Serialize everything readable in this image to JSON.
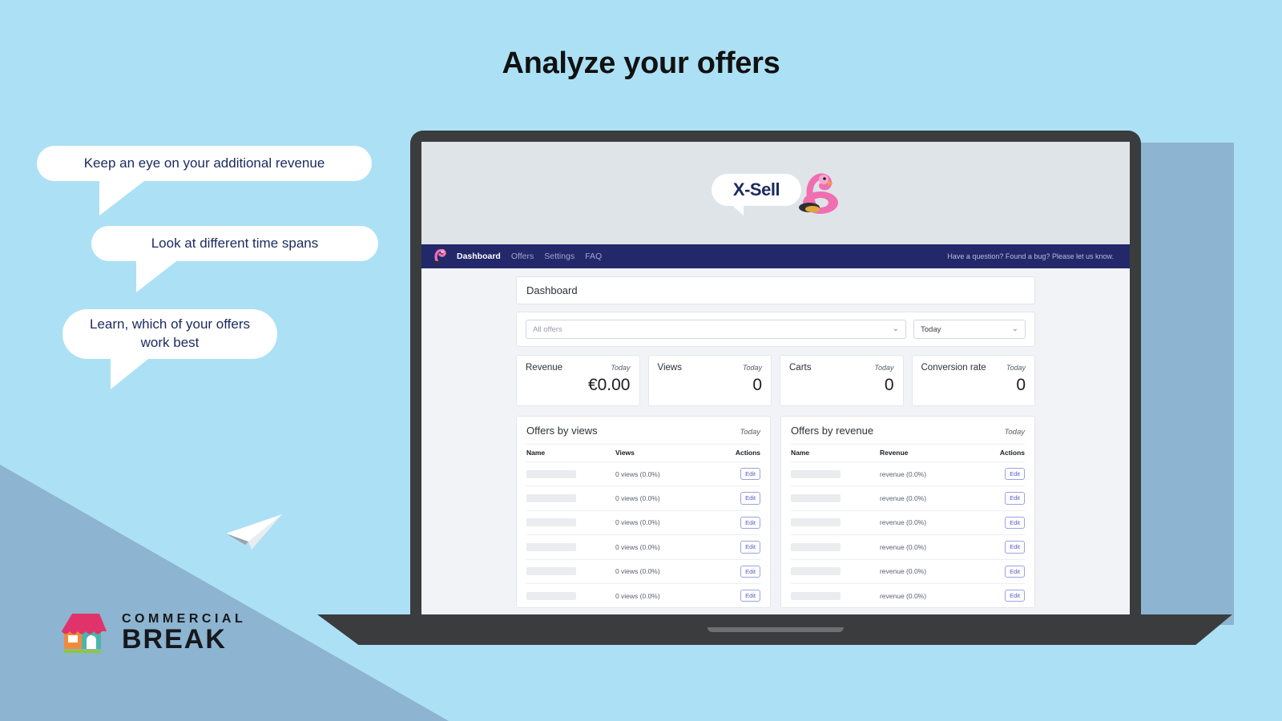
{
  "page": {
    "headline": "Analyze your offers",
    "background_color": "#ace0f5",
    "accent_color": "#23286b"
  },
  "callouts": [
    {
      "text": "Keep an eye on your additional revenue"
    },
    {
      "text": "Look at different time spans"
    },
    {
      "text": "Learn, which of your offers work best"
    }
  ],
  "brand_logo": {
    "line1": "COMMERCIAL",
    "line2": "BREAK",
    "icon": "shop-icon"
  },
  "decor": {
    "paper_plane_icon": "paper-plane-icon"
  },
  "app": {
    "logo": {
      "text": "X-Sell",
      "mascot_icon": "flamingo-float-icon"
    },
    "navbar": {
      "brand_icon": "flamingo-icon",
      "links": [
        {
          "label": "Dashboard",
          "active": true
        },
        {
          "label": "Offers",
          "active": false
        },
        {
          "label": "Settings",
          "active": false
        },
        {
          "label": "FAQ",
          "active": false
        }
      ],
      "support_text": "Have a question? Found a bug? Please let us know."
    },
    "page_title": "Dashboard",
    "filters": {
      "offers_select": {
        "value": "All offers",
        "placeholder": "All offers",
        "chevron_icon": "chevron-down-icon"
      },
      "period_select": {
        "value": "Today",
        "chevron_icon": "chevron-down-icon"
      }
    },
    "stats": [
      {
        "label": "Revenue",
        "period": "Today",
        "value": "€0.00"
      },
      {
        "label": "Views",
        "period": "Today",
        "value": "0"
      },
      {
        "label": "Carts",
        "period": "Today",
        "value": "0"
      },
      {
        "label": "Conversion rate",
        "period": "Today",
        "value": "0"
      }
    ],
    "tables": [
      {
        "title": "Offers by views",
        "period": "Today",
        "columns": [
          "Name",
          "Views",
          "Actions"
        ],
        "action_label": "Edit",
        "rows": [
          {
            "name": "",
            "metric": "0 views (0.0%)"
          },
          {
            "name": "",
            "metric": "0 views (0.0%)"
          },
          {
            "name": "",
            "metric": "0 views (0.0%)"
          },
          {
            "name": "",
            "metric": "0 views (0.0%)"
          },
          {
            "name": "",
            "metric": "0 views (0.0%)"
          },
          {
            "name": "",
            "metric": "0 views (0.0%)"
          }
        ]
      },
      {
        "title": "Offers by revenue",
        "period": "Today",
        "columns": [
          "Name",
          "Revenue",
          "Actions"
        ],
        "action_label": "Edit",
        "rows": [
          {
            "name": "",
            "metric": "revenue (0.0%)"
          },
          {
            "name": "",
            "metric": "revenue (0.0%)"
          },
          {
            "name": "",
            "metric": "revenue (0.0%)"
          },
          {
            "name": "",
            "metric": "revenue (0.0%)"
          },
          {
            "name": "",
            "metric": "revenue (0.0%)"
          },
          {
            "name": "",
            "metric": "revenue (0.0%)"
          }
        ]
      }
    ]
  }
}
